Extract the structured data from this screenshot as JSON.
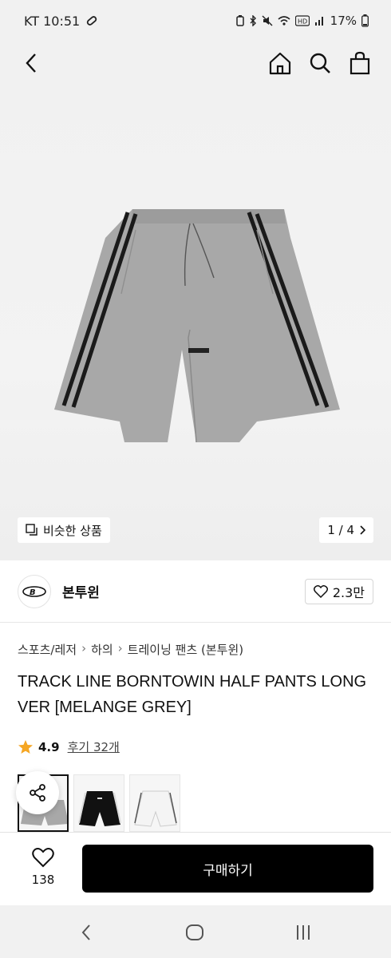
{
  "status_bar": {
    "carrier_time": "KT 10:51",
    "battery": "17%"
  },
  "header": {
    "back_icon": "chevron-left-icon",
    "actions": [
      "home-icon",
      "search-icon",
      "bag-icon"
    ]
  },
  "hero": {
    "similar_label": "비슷한 상품",
    "pager": "1 / 4"
  },
  "brand": {
    "name": "본투윈",
    "likes": "2.3만"
  },
  "breadcrumb": [
    "스포츠/레저",
    "하의",
    "트레이닝 팬츠 (본투윈)"
  ],
  "product": {
    "title": "TRACK LINE BORNTOWIN HALF PANTS LONG VER [MELANGE GREY]",
    "rating": "4.9",
    "reviews": "후기 32개"
  },
  "bottom_bar": {
    "wish_count": "138",
    "buy_label": "구매하기"
  },
  "colors": {
    "accent_star": "#F5A623",
    "buy_button": "#000000"
  }
}
